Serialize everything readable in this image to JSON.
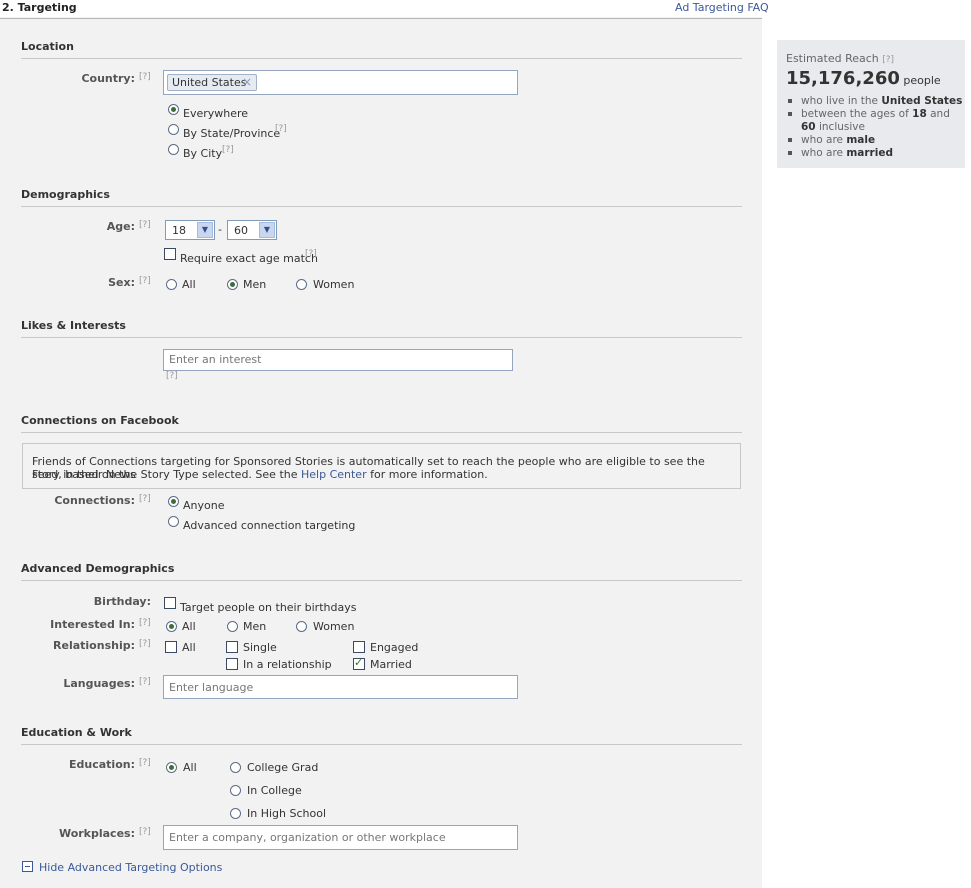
{
  "header": {
    "title": "2. Targeting",
    "faq_link": "Ad Targeting FAQ"
  },
  "help": "[?]",
  "location": {
    "section_title": "Location",
    "country_label": "Country:",
    "country_token": "United States",
    "token_remove": "×",
    "options": [
      "Everywhere",
      "By State/Province",
      "By City"
    ],
    "selected": "Everywhere"
  },
  "demographics": {
    "section_title": "Demographics",
    "age_label": "Age:",
    "age_min": "18",
    "age_sep": "-",
    "age_max": "60",
    "exact_match": "Require exact age match",
    "sex_label": "Sex:",
    "sex_options": [
      "All",
      "Men",
      "Women"
    ],
    "sex_selected": "Men"
  },
  "interests": {
    "section_title": "Likes & Interests",
    "placeholder": "Enter an interest"
  },
  "connections": {
    "section_title": "Connections on Facebook",
    "info_text_1": "Friends of Connections targeting for Sponsored Stories is automatically set to reach the people who are eligible to see the story in their News",
    "info_text_2a": "Feed, based on the Story Type selected. See the",
    "info_link": "Help Center",
    "info_text_2b": "for more information.",
    "label": "Connections:",
    "options": [
      "Anyone",
      "Advanced connection targeting"
    ],
    "selected": "Anyone"
  },
  "advanced": {
    "section_title": "Advanced Demographics",
    "birthday_label": "Birthday:",
    "birthday_option": "Target people on their birthdays",
    "interested_label": "Interested In:",
    "interested_options": [
      "All",
      "Men",
      "Women"
    ],
    "interested_selected": "All",
    "relationship_label": "Relationship:",
    "relationship_options": [
      "All",
      "Single",
      "Engaged",
      "In a relationship",
      "Married"
    ],
    "relationship_checked": [
      "Married"
    ],
    "languages_label": "Languages:",
    "languages_placeholder": "Enter language"
  },
  "education": {
    "section_title": "Education & Work",
    "education_label": "Education:",
    "options": [
      "All",
      "College Grad",
      "In College",
      "In High School"
    ],
    "selected": "All",
    "workplaces_label": "Workplaces:",
    "workplaces_placeholder": "Enter a company, organization or other workplace"
  },
  "footer": {
    "hide_link": "Hide Advanced Targeting Options"
  },
  "reach": {
    "title": "Estimated Reach",
    "count": "15,176,260",
    "unit": "people",
    "line1_pre": "who live in the",
    "line1_b": "United States",
    "line2_pre": "between the ages of",
    "line2_b1": "18",
    "line2_mid": "and",
    "line3_b": "60",
    "line3_post": "inclusive",
    "line4_pre": "who are",
    "line4_b": "male",
    "line5_pre": "who are",
    "line5_b": "married"
  },
  "colors": {
    "link": "#3b5998",
    "panel": "#f2f2f2",
    "reach_bg": "#e9eaed"
  }
}
